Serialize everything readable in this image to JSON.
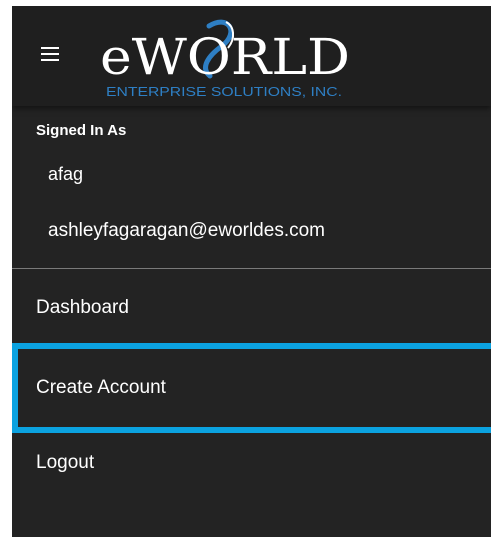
{
  "header": {
    "menu_icon": "hamburger-menu-icon",
    "logo": {
      "brand": "eWORLD",
      "tagline": "ENTERPRISE SOLUTIONS, INC.",
      "accent_color": "#2e7fc4"
    }
  },
  "account": {
    "signed_in_label": "Signed In As",
    "username": "afag",
    "email": "ashleyfagaragan@eworldes.com"
  },
  "nav": {
    "items": [
      {
        "label": "Dashboard",
        "selected": false
      },
      {
        "label": "Create Account",
        "selected": true
      },
      {
        "label": "Logout",
        "selected": false
      }
    ]
  },
  "colors": {
    "background": "#232323",
    "header": "#1f1f1f",
    "selected_border": "#0ba2e0",
    "text": "#ffffff",
    "divider": "#7a7a7a"
  }
}
